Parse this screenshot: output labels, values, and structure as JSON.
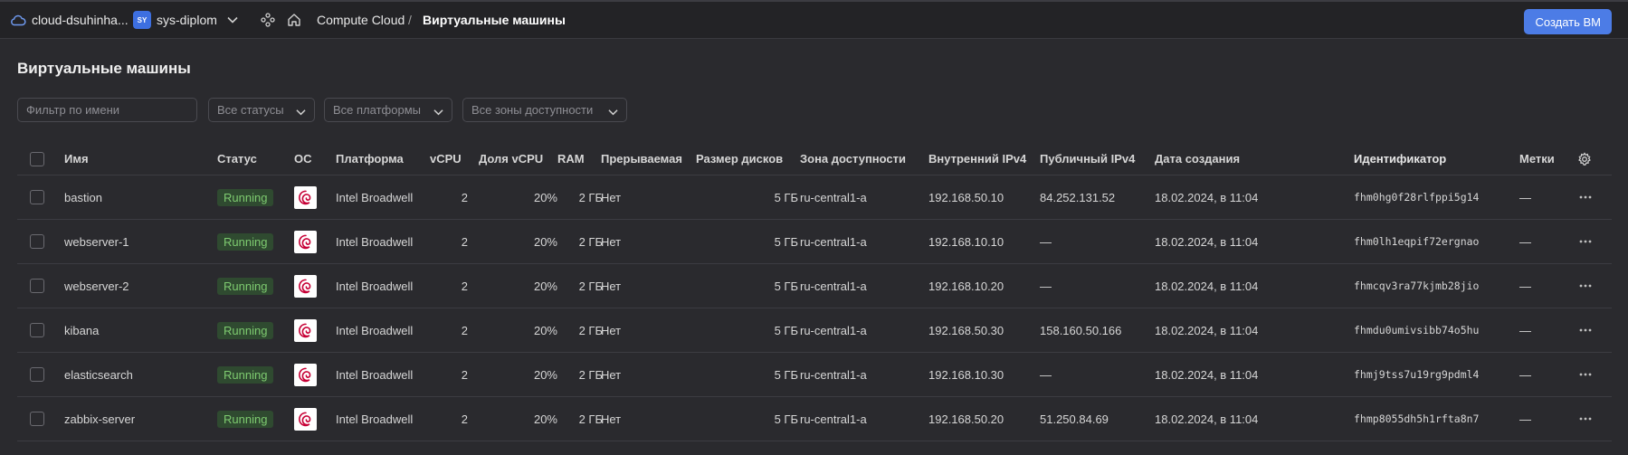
{
  "header": {
    "cloud_name": "cloud-dsuhinha...",
    "folder_badge": "SY",
    "folder_name": "sys-diplom",
    "breadcrumb_service": "Compute Cloud",
    "breadcrumb_sep": "/",
    "breadcrumb_current": "Виртуальные машины",
    "create_button": "Создать ВМ",
    "accent_color": "#4c7ce6"
  },
  "page": {
    "title": "Виртуальные машины"
  },
  "filters": {
    "name_placeholder": "Фильтр по имени",
    "status": "Все статусы",
    "platform": "Все платформы",
    "zone": "Все зоны доступности"
  },
  "table": {
    "columns": {
      "name": "Имя",
      "status": "Статус",
      "os": "ОС",
      "platform": "Платформа",
      "vcpu": "vCPU",
      "vcpu_share": "Доля vCPU",
      "ram": "RAM",
      "preemptible": "Прерываемая",
      "disk": "Размер дисков",
      "zone": "Зона доступности",
      "internal_ip": "Внутренний IPv4",
      "public_ip": "Публичный IPv4",
      "created": "Дата создания",
      "id": "Идентификатор",
      "tags": "Метки"
    },
    "rows": [
      {
        "name": "bastion",
        "status": "Running",
        "platform": "Intel Broadwell",
        "vcpu": "2",
        "share": "20%",
        "ram": "2 ГБ",
        "pre": "Нет",
        "disk": "5 ГБ",
        "zone": "ru-central1-a",
        "ip": "192.168.50.10",
        "pub": "84.252.131.52",
        "date": "18.02.2024, в 11:04",
        "id": "fhm0hg0f28rlfppi5g14",
        "tags": "—"
      },
      {
        "name": "webserver-1",
        "status": "Running",
        "platform": "Intel Broadwell",
        "vcpu": "2",
        "share": "20%",
        "ram": "2 ГБ",
        "pre": "Нет",
        "disk": "5 ГБ",
        "zone": "ru-central1-a",
        "ip": "192.168.10.10",
        "pub": "—",
        "date": "18.02.2024, в 11:04",
        "id": "fhm0lh1eqpif72ergnao",
        "tags": "—"
      },
      {
        "name": "webserver-2",
        "status": "Running",
        "platform": "Intel Broadwell",
        "vcpu": "2",
        "share": "20%",
        "ram": "2 ГБ",
        "pre": "Нет",
        "disk": "5 ГБ",
        "zone": "ru-central1-a",
        "ip": "192.168.10.20",
        "pub": "—",
        "date": "18.02.2024, в 11:04",
        "id": "fhmcqv3ra77kjmb28jio",
        "tags": "—"
      },
      {
        "name": "kibana",
        "status": "Running",
        "platform": "Intel Broadwell",
        "vcpu": "2",
        "share": "20%",
        "ram": "2 ГБ",
        "pre": "Нет",
        "disk": "5 ГБ",
        "zone": "ru-central1-a",
        "ip": "192.168.50.30",
        "pub": "158.160.50.166",
        "date": "18.02.2024, в 11:04",
        "id": "fhmdu0umivsibb74o5hu",
        "tags": "—"
      },
      {
        "name": "elasticsearch",
        "status": "Running",
        "platform": "Intel Broadwell",
        "vcpu": "2",
        "share": "20%",
        "ram": "2 ГБ",
        "pre": "Нет",
        "disk": "5 ГБ",
        "zone": "ru-central1-a",
        "ip": "192.168.10.30",
        "pub": "—",
        "date": "18.02.2024, в 11:04",
        "id": "fhmj9tss7u19rg9pdml4",
        "tags": "—"
      },
      {
        "name": "zabbix-server",
        "status": "Running",
        "platform": "Intel Broadwell",
        "vcpu": "2",
        "share": "20%",
        "ram": "2 ГБ",
        "pre": "Нет",
        "disk": "5 ГБ",
        "zone": "ru-central1-a",
        "ip": "192.168.50.20",
        "pub": "51.250.84.69",
        "date": "18.02.2024, в 11:04",
        "id": "fhmp8055dh5h1rfta8n7",
        "tags": "—"
      }
    ]
  },
  "icons": {
    "cloud": "cloud-icon",
    "apps": "services-icon",
    "home": "home-icon",
    "os": "debian-logo-icon",
    "settings": "gear-icon",
    "row_menu": "more-horizontal-icon"
  },
  "status_color": "#7ecb70"
}
